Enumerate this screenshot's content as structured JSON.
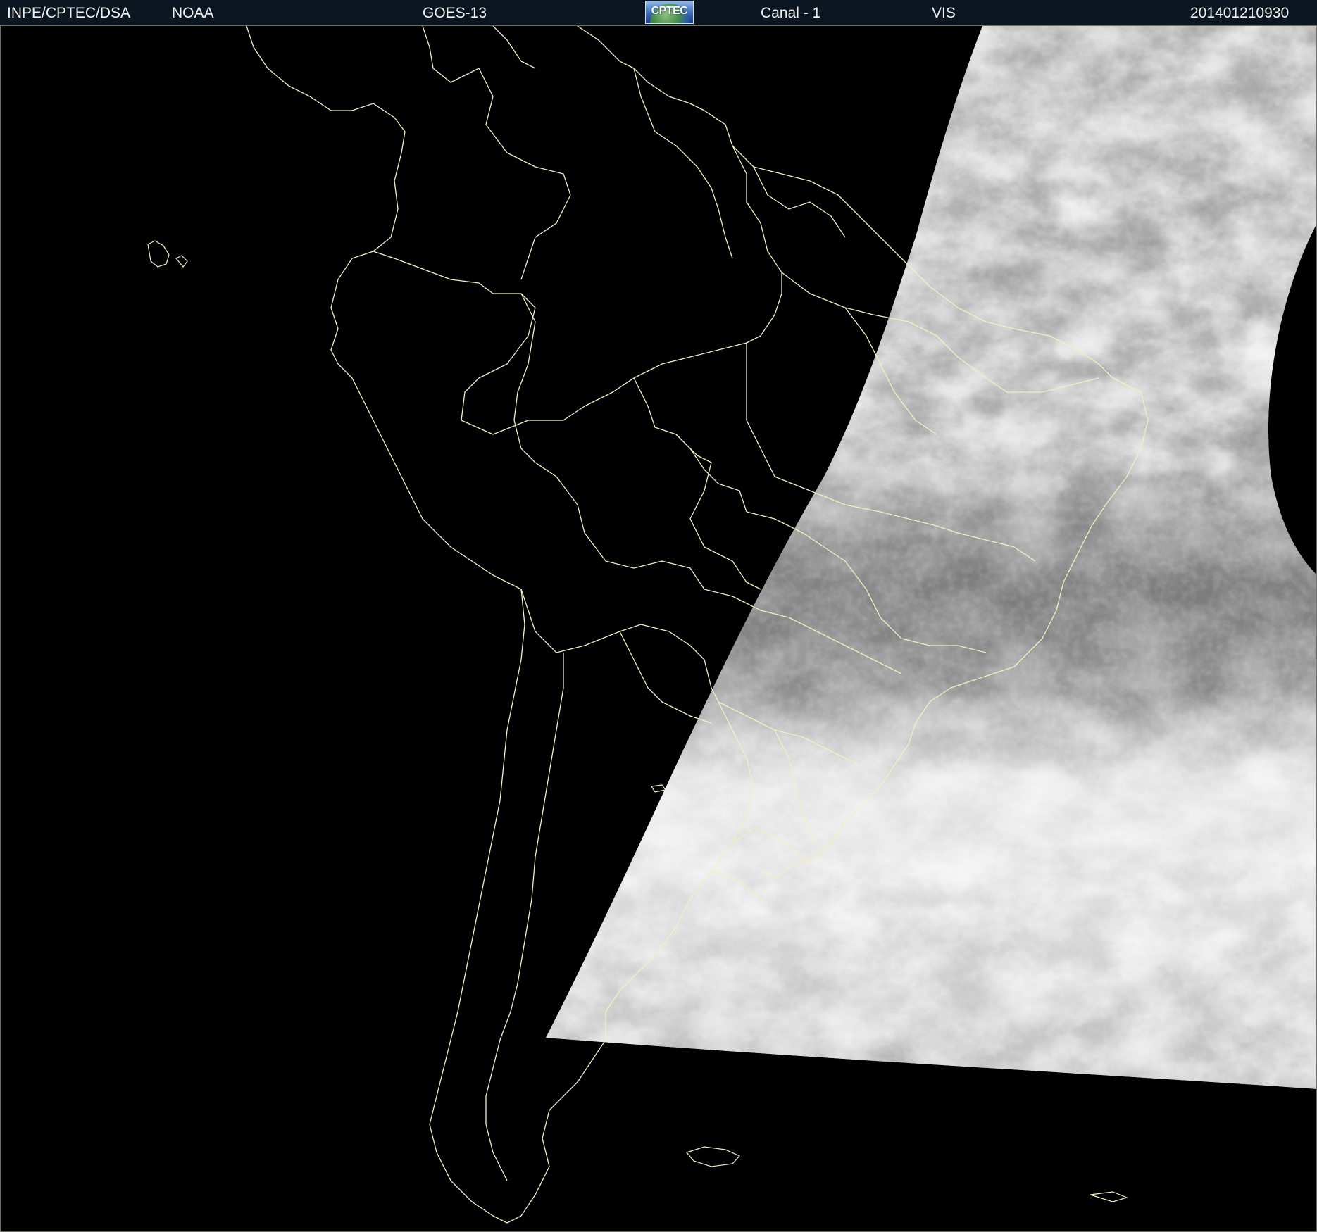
{
  "header": {
    "source": "INPE/CPTEC/DSA",
    "agency": "NOAA",
    "satellite": "GOES-13",
    "logo_text": "CPTEC",
    "channel": "Canal - 1",
    "band": "VIS",
    "timestamp": "201401210930"
  },
  "colors": {
    "header_background": "#0b1620",
    "header_text": "#f2f2f2",
    "coastline": "#f0f0c0",
    "space_background": "#000000"
  }
}
